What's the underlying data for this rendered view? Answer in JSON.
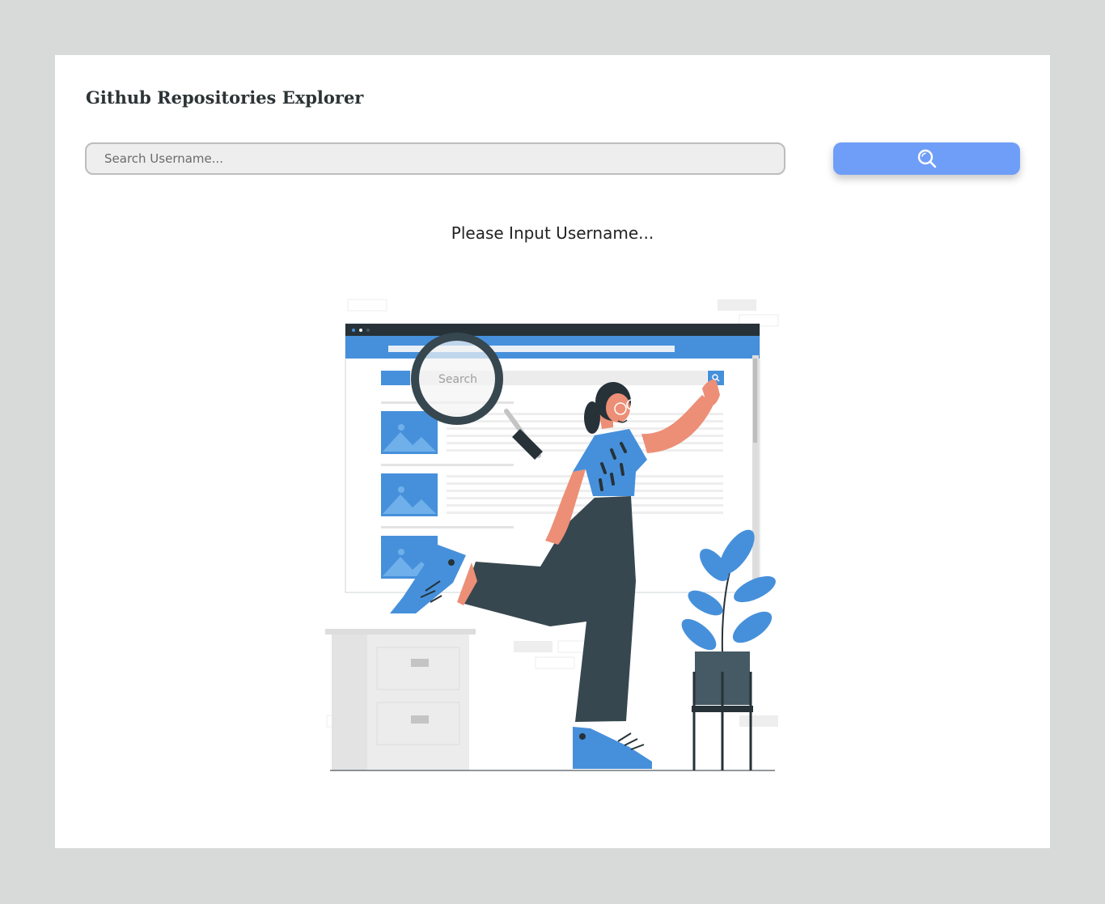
{
  "header": {
    "title": "Github Repositories Explorer"
  },
  "search": {
    "placeholder": "Search Username...",
    "value": "",
    "button_icon": "search-icon"
  },
  "main": {
    "status_text": "Please Input Username...",
    "illustration": {
      "search_box_text": "Search"
    }
  },
  "colors": {
    "page_background": "#d8dad9",
    "card": "#ffffff",
    "accent": "#6f9ef9",
    "illustration_blue": "#4690db",
    "dark": "#37474f"
  }
}
